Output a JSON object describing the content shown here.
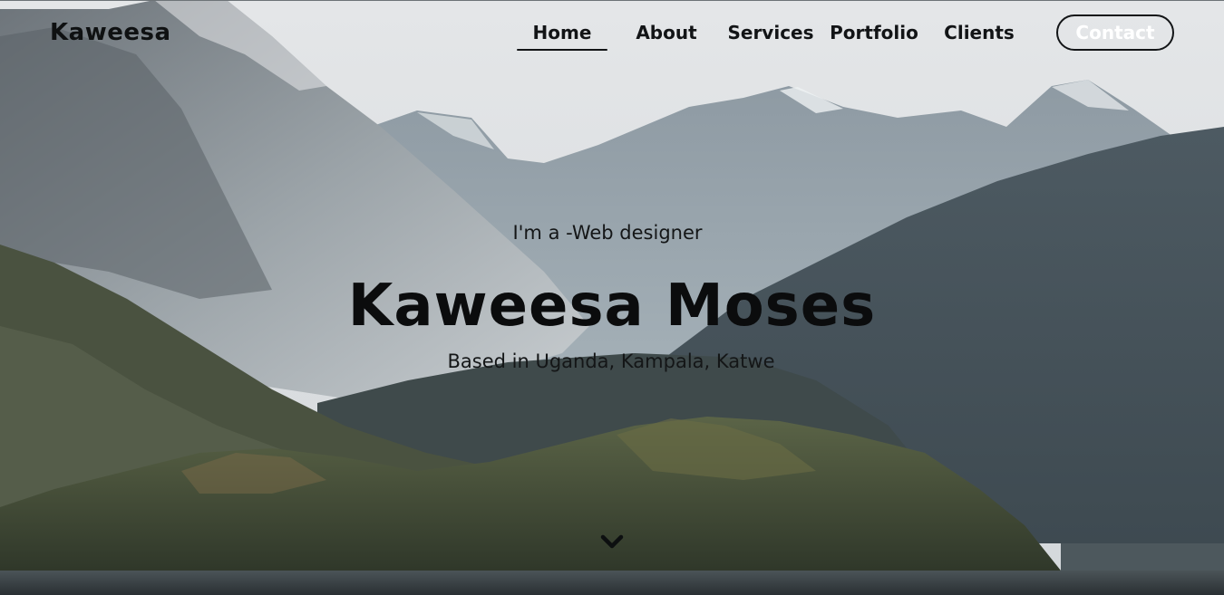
{
  "header": {
    "logo": "Kaweesa",
    "nav": [
      {
        "label": "Home",
        "active": true
      },
      {
        "label": "About",
        "active": false
      },
      {
        "label": "Services",
        "active": false
      },
      {
        "label": "Portfolio",
        "active": false
      },
      {
        "label": "Clients",
        "active": false
      }
    ],
    "contact_label": "Contact"
  },
  "hero": {
    "tagline": "I'm a -Web designer",
    "name": "Kaweesa Moses",
    "location": "Based in Uganda, Kampala, Katwe",
    "scroll_icon": "chevron-down-icon"
  },
  "colors": {
    "text": "#121416",
    "contact_text": "#ffffff",
    "sky": "#dfe2e4"
  }
}
